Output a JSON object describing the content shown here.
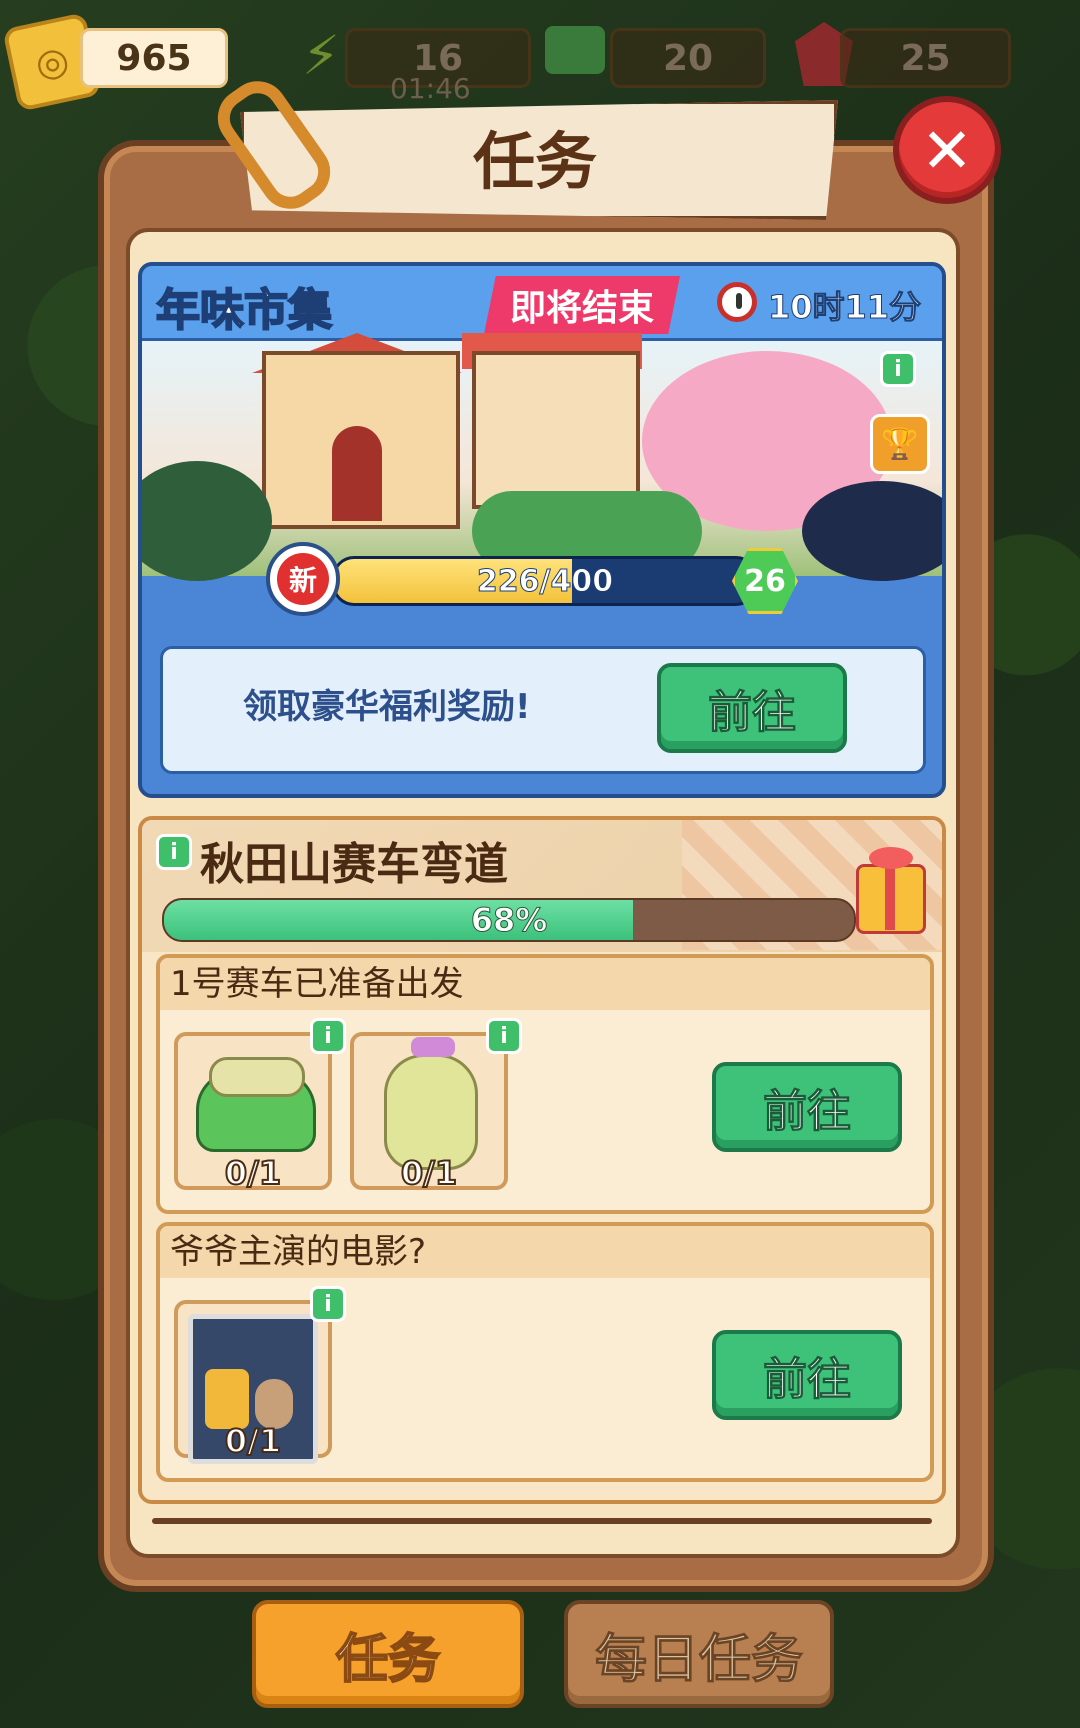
{
  "topbar": {
    "tickets": "965",
    "energy": "16",
    "energy_timer": "01:46",
    "cash": "20",
    "gems": "25"
  },
  "panel": {
    "title": "任务"
  },
  "event": {
    "title": "年味市集",
    "tag": "即将结束",
    "time_left": "10时11分",
    "progress_text": "226/400",
    "progress_fraction": 0.565,
    "new_badge": "新",
    "level": "26",
    "reward_text": "领取豪华福利奖励!",
    "go_label": "前往"
  },
  "quest": {
    "title": "秋田山赛车弯道",
    "progress_text": "68%",
    "progress_fraction": 0.68,
    "tasks": [
      {
        "title": "1号赛车已准备出发",
        "go_label": "前往",
        "items": [
          {
            "icon": "ottoman-icon",
            "count": "0/1"
          },
          {
            "icon": "bottle-icon",
            "count": "0/1"
          }
        ]
      },
      {
        "title": "爷爷主演的电影?",
        "go_label": "前往",
        "items": [
          {
            "icon": "movie-poster-icon",
            "count": "0/1"
          }
        ]
      }
    ]
  },
  "tabs": {
    "tasks": "任务",
    "daily": "每日任务"
  },
  "icons": {
    "info": "i",
    "close": "✕"
  }
}
